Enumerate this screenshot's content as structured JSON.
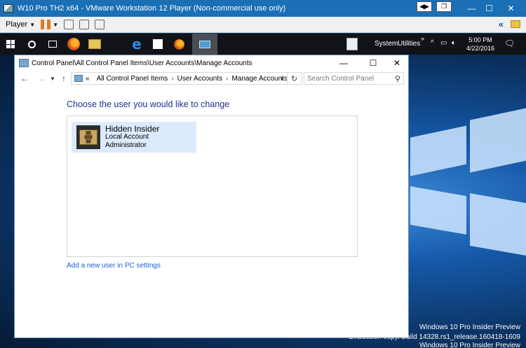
{
  "vm": {
    "title": "W10 Pro TH2 x64 - VMware Workstation 12 Player (Non-commercial use only)",
    "menu_player": "Player"
  },
  "taskbar": {
    "system_label": "System",
    "utilities_label": "Utilities",
    "tray_chevron": "»",
    "time": "5:00 PM",
    "date": "4/22/2016"
  },
  "window": {
    "title": "Control Panel\\All Control Panel Items\\User Accounts\\Manage Accounts",
    "breadcrumb": [
      "All Control Panel Items",
      "User Accounts",
      "Manage Accounts"
    ],
    "search_placeholder": "Search Control Panel"
  },
  "main": {
    "heading": "Choose the user you would like to change",
    "account": {
      "name": "Hidden Insider",
      "type": "Local Account",
      "role": "Administrator"
    },
    "add_user_link": "Add a new user in PC settings"
  },
  "desktop": {
    "watermark_line1": "Windows 10 Pro Insider Preview",
    "watermark_line2": "Evaluation copy. Build 14328.rs1_release.160418-1609",
    "watermark_line3": "Windows 10 Pro Insider Preview"
  }
}
